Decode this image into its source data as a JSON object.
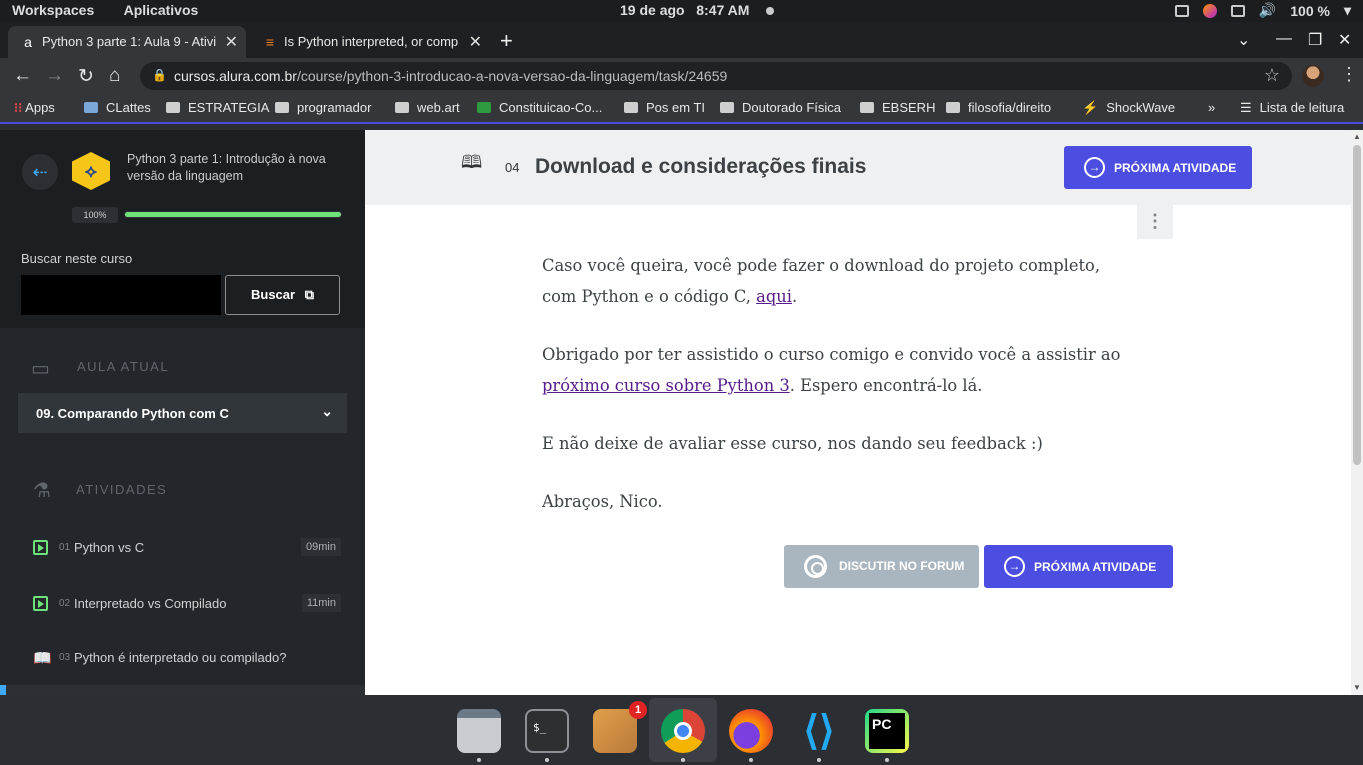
{
  "os_bar": {
    "workspaces": "Workspaces",
    "apps": "Aplicativos",
    "date": "19 de ago",
    "time": "8:47 AM",
    "battery": "100 %"
  },
  "tabs": [
    {
      "title": "Python 3 parte 1: Aula 9 - Ativi",
      "favicon": "a",
      "active": true
    },
    {
      "title": "Is Python interpreted, or comp",
      "favicon": "stackoverflow-icon",
      "active": false
    }
  ],
  "address": {
    "host": "cursos.alura.com.br",
    "path": "/course/python-3-introducao-a-nova-versao-da-linguagem/task/24659"
  },
  "bookmarks": {
    "apps": "Apps",
    "items": [
      "CLattes",
      "ESTRATEGIA",
      "programador",
      "web.art",
      "Constituicao-Co...",
      "Pos em TI",
      "Doutorado Física",
      "EBSERH",
      "filosofia/direito",
      "ShockWave"
    ],
    "reading_list": "Lista de leitura"
  },
  "sidebar": {
    "course_title": "Python 3 parte 1: Introdução à nova versão da linguagem",
    "progress_label": "100%",
    "progress": 1.0,
    "search_label": "Buscar neste curso",
    "search_value": "",
    "search_button": "Buscar",
    "current_section_label": "AULA ATUAL",
    "current_lesson": "09. Comparando Python com C",
    "activities_label": "ATIVIDADES",
    "activities": [
      {
        "num": "01",
        "label": "Python vs C",
        "duration": "09min",
        "type": "video"
      },
      {
        "num": "02",
        "label": "Interpretado vs Compilado",
        "duration": "11min",
        "type": "video"
      },
      {
        "num": "03",
        "label": "Python é interpretado ou compilado?",
        "duration": "",
        "type": "reading"
      }
    ]
  },
  "main": {
    "task_number": "04",
    "task_title": "Download e considerações finais",
    "next_button": "PRÓXIMA ATIVIDADE",
    "forum_button": "DISCUTIR NO FORUM",
    "p1_text": "Caso você queira, você pode fazer o download do projeto completo, com Python e o código C, ",
    "p1_link": "aqui",
    "p1_end": ".",
    "p2_text": "Obrigado por ter assistido o curso comigo e convido você a assistir ao ",
    "p2_link": "próximo curso sobre Python 3",
    "p2_end": ". Espero encontrá-lo lá.",
    "p3": "E não deixe de avaliar esse curso, nos dando seu feedback :)",
    "p4": "Abraços, Nico."
  },
  "dock": {
    "apps": [
      "files-icon",
      "terminal-icon",
      "launcher-icon",
      "chrome-icon",
      "firefox-icon",
      "vscode-icon",
      "pycharm-icon"
    ],
    "badge_count": "1"
  },
  "colors": {
    "accent": "#4b4ee0",
    "progress_green": "#6fe37a",
    "sidebar_bg": "#23272b"
  }
}
